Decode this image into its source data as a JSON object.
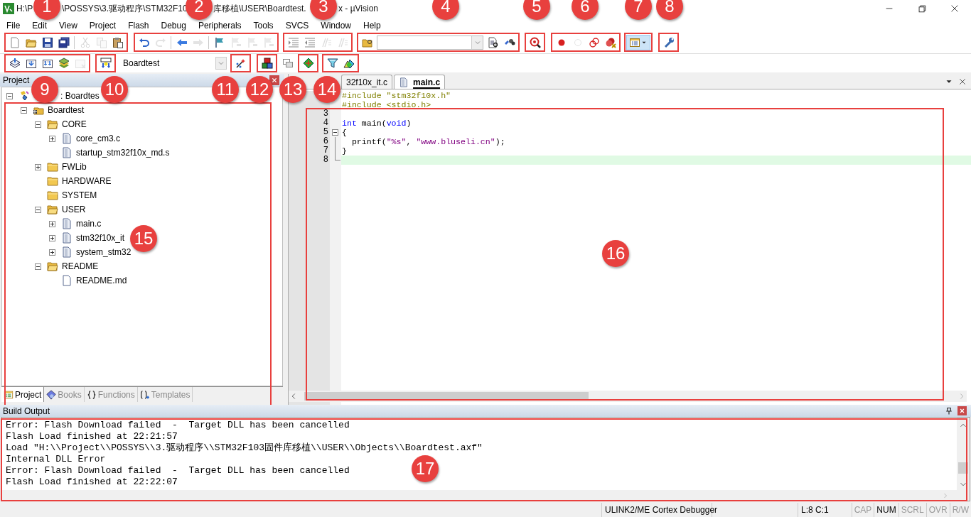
{
  "window": {
    "title_parts": [
      "H:\\P",
      "\\POSSYS\\3.驱动程序\\STM32F10",
      "库移植\\USER\\Boardtest.",
      "x - µVision"
    ]
  },
  "menu": [
    "File",
    "Edit",
    "View",
    "Project",
    "Flash",
    "Debug",
    "Peripherals",
    "Tools",
    "SVCS",
    "Window",
    "Help"
  ],
  "toolbar_1": [
    {
      "highlighted": true,
      "buttons": [
        {
          "disabled": false
        },
        {
          "disabled": false
        },
        {
          "disabled": false
        },
        {
          "disabled": false
        },
        {
          "disabled": true
        },
        {
          "disabled": true
        },
        {
          "disabled": false
        }
      ]
    },
    {
      "highlighted": true,
      "buttons": [
        {
          "disabled": false
        },
        {
          "disabled": true
        },
        {
          "disabled": false
        },
        {
          "disabled": true
        },
        {
          "disabled": false
        },
        {
          "disabled": true
        },
        {
          "disabled": true
        },
        {
          "disabled": true
        }
      ]
    },
    {
      "highlighted": true,
      "buttons": [
        {
          "disabled": false
        },
        {
          "disabled": false
        },
        {
          "disabled": true
        },
        {
          "disabled": true
        }
      ]
    },
    {
      "highlighted": true,
      "buttons": [
        {
          "disabled": false
        },
        {
          "disabled": false
        },
        {
          "disabled": false
        }
      ]
    },
    {
      "highlighted": true,
      "buttons": [
        {
          "disabled": false
        }
      ]
    },
    {
      "highlighted": true,
      "buttons": [
        {
          "disabled": false
        },
        {
          "disabled": true
        },
        {
          "disabled": false
        },
        {
          "disabled": false
        }
      ]
    },
    {
      "highlighted": true,
      "buttons": [
        {
          "disabled": false,
          "pressed": true
        }
      ]
    },
    {
      "highlighted": true,
      "buttons": [
        {
          "disabled": false
        }
      ]
    }
  ],
  "toolbar_2": [
    {
      "highlighted": true,
      "buttons": [
        {
          "disabled": false
        },
        {
          "disabled": false
        },
        {
          "disabled": false
        },
        {
          "disabled": false
        },
        {
          "disabled": true
        }
      ]
    },
    {
      "highlighted": true,
      "buttons": [
        {
          "disabled": false
        }
      ]
    },
    {
      "kind": "select",
      "value": "Boardtest"
    },
    {
      "highlighted": true,
      "buttons": [
        {
          "disabled": false
        }
      ]
    },
    {
      "highlighted": true,
      "buttons": [
        {
          "disabled": false
        }
      ]
    },
    {
      "highlighted": false,
      "buttons": [
        {
          "disabled": false
        }
      ]
    },
    {
      "highlighted": true,
      "buttons": [
        {
          "disabled": false
        }
      ]
    },
    {
      "highlighted": true,
      "buttons": [
        {
          "disabled": false
        },
        {
          "disabled": false
        }
      ]
    }
  ],
  "project_panel": {
    "title": "Project",
    "highlighted": true,
    "tree": [
      {
        "kind": "target",
        "label": ": Boardtes",
        "expanded": true,
        "children": [
          {
            "kind": "group",
            "label": "Boardtest",
            "expanded": true,
            "children": [
              {
                "kind": "folder",
                "label": "CORE",
                "expanded": true,
                "children": [
                  {
                    "kind": "file",
                    "label": "core_cm3.c",
                    "expanded": false
                  },
                  {
                    "kind": "file",
                    "label": "startup_stm32f10x_md.s"
                  }
                ]
              },
              {
                "kind": "folder",
                "label": "FWLib",
                "expanded": false
              },
              {
                "kind": "folder",
                "label": "HARDWARE"
              },
              {
                "kind": "folder",
                "label": "SYSTEM"
              },
              {
                "kind": "folder",
                "label": "USER",
                "expanded": true,
                "children": [
                  {
                    "kind": "file",
                    "label": "main.c",
                    "expanded": false
                  },
                  {
                    "kind": "file",
                    "label": "stm32f10x_it",
                    "expanded": false
                  },
                  {
                    "kind": "file",
                    "label": "system_stm32",
                    "expanded": false
                  }
                ]
              },
              {
                "kind": "folder",
                "label": "README",
                "expanded": true,
                "children": [
                  {
                    "kind": "doc",
                    "label": "README.md"
                  }
                ]
              }
            ]
          }
        ]
      }
    ],
    "tabs": [
      {
        "label": "Project",
        "selected": true
      },
      {
        "label": "Books",
        "selected": false
      },
      {
        "label": "Functions",
        "selected": false
      },
      {
        "label": "Templates",
        "selected": false
      }
    ]
  },
  "editor": {
    "highlighted": true,
    "tabs": [
      {
        "label": "32f10x_it.c",
        "selected": false
      },
      {
        "label": "main.c",
        "selected": true
      }
    ],
    "lines": [
      {
        "tokens": [
          {
            "kind": "preproc",
            "text": "#include \"stm32f10x.h\""
          }
        ]
      },
      {
        "tokens": [
          {
            "kind": "preproc",
            "text": "#include <stdio.h>"
          }
        ]
      },
      {
        "number": "3"
      },
      {
        "number": "4",
        "tokens": [
          {
            "kind": "keyword",
            "text": "int"
          },
          {
            "kind": "plain",
            "text": " main("
          },
          {
            "kind": "keyword",
            "text": "void"
          },
          {
            "kind": "plain",
            "text": ")"
          }
        ]
      },
      {
        "number": "5",
        "expanded": true,
        "tokens": [
          {
            "kind": "plain",
            "text": "{"
          }
        ]
      },
      {
        "number": "6",
        "tokens": [
          {
            "kind": "plain",
            "text": "  printf("
          },
          {
            "kind": "string",
            "text": "\"%s\""
          },
          {
            "kind": "plain",
            "text": ", "
          },
          {
            "kind": "string",
            "text": "\"www.bluseli.cn\""
          },
          {
            "kind": "plain",
            "text": ");"
          }
        ]
      },
      {
        "number": "7",
        "tokens": [
          {
            "kind": "plain",
            "text": "}"
          }
        ]
      },
      {
        "number": "8",
        "current": true
      }
    ]
  },
  "build_output": {
    "title": "Build Output",
    "highlighted": true,
    "lines": [
      "Error: Flash Download failed  -  Target DLL has been cancelled",
      "Flash Load finished at 22:21:57",
      "Load \"H:\\\\Project\\\\POSSYS\\\\3.驱动程序\\\\STM32F103固件库移植\\\\USER\\\\Objects\\\\Boardtest.axf\"",
      "Internal DLL Error",
      "Error: Flash Download failed  -  Target DLL has been cancelled",
      "Flash Load finished at 22:22:07"
    ]
  },
  "status_bar": {
    "debugger": "ULINK2/ME Cortex Debugger",
    "position": "L:8 C:1",
    "indicators": [
      {
        "label": "CAP",
        "on": false
      },
      {
        "label": "NUM",
        "on": true
      },
      {
        "label": "SCRL",
        "on": false
      },
      {
        "label": "OVR",
        "on": false
      },
      {
        "label": "R/W",
        "on": false
      }
    ]
  },
  "annotations": [
    {
      "label": "1"
    },
    {
      "label": "2"
    },
    {
      "label": "3"
    },
    {
      "label": "4"
    },
    {
      "label": "5"
    },
    {
      "label": "6"
    },
    {
      "label": "7"
    },
    {
      "label": "8"
    },
    {
      "label": "9"
    },
    {
      "label": "10"
    },
    {
      "label": "11"
    },
    {
      "label": "12"
    },
    {
      "label": "13"
    },
    {
      "label": "14"
    },
    {
      "label": "15"
    },
    {
      "label": "16"
    },
    {
      "label": "17"
    }
  ]
}
